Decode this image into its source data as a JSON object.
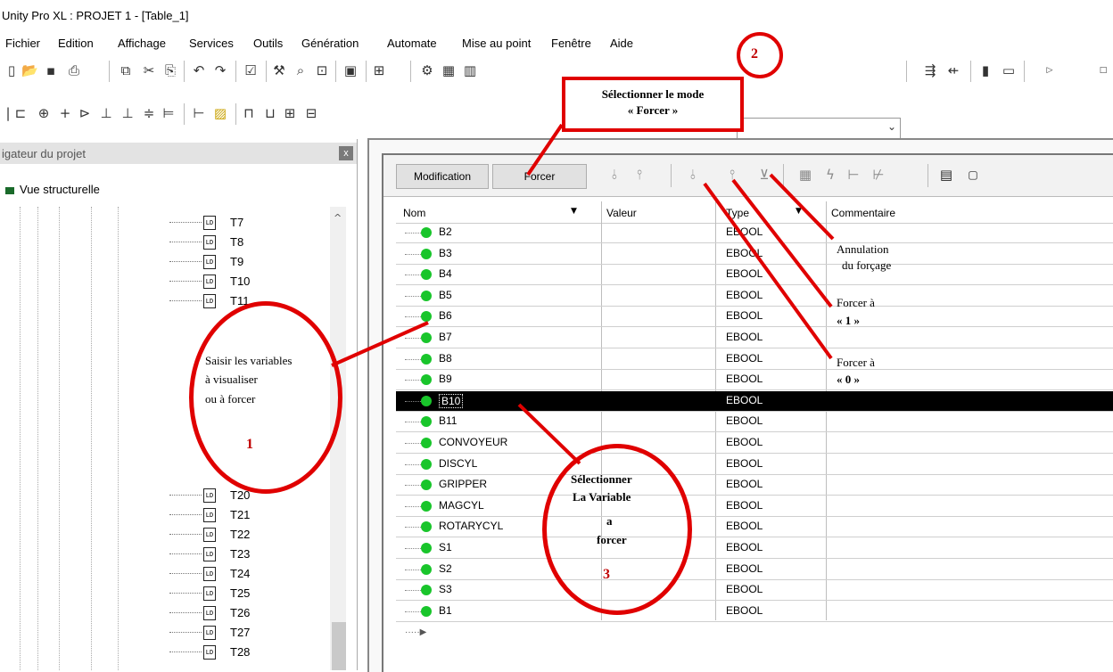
{
  "window": {
    "title": "Unity Pro XL : PROJET 1 - [Table_1]"
  },
  "menu": [
    "Fichier",
    "Edition",
    "Affichage",
    "Services",
    "Outils",
    "Génération",
    "Automate",
    "Mise au point",
    "Fenêtre",
    "Aide"
  ],
  "navigator": {
    "header": "igateur du projet",
    "close": "x",
    "structural_view": "Vue structurelle",
    "tree_items": [
      "T7",
      "T8",
      "T9",
      "T10",
      "T11",
      "T20",
      "T21",
      "T22",
      "T23",
      "T24",
      "T25",
      "T26",
      "T27",
      "T28"
    ],
    "ld_icon_text": "LD"
  },
  "var_table": {
    "buttons": {
      "modification": "Modification",
      "forcer": "Forcer"
    },
    "columns": {
      "name": "Nom",
      "value": "Valeur",
      "type": "Type",
      "comment": "Commentaire"
    },
    "rows": [
      {
        "name": "B2",
        "type": "EBOOL"
      },
      {
        "name": "B3",
        "type": "EBOOL"
      },
      {
        "name": "B4",
        "type": "EBOOL"
      },
      {
        "name": "B5",
        "type": "EBOOL"
      },
      {
        "name": "B6",
        "type": "EBOOL"
      },
      {
        "name": "B7",
        "type": "EBOOL"
      },
      {
        "name": "B8",
        "type": "EBOOL"
      },
      {
        "name": "B9",
        "type": "EBOOL"
      },
      {
        "name": "B10",
        "type": "EBOOL",
        "selected": true
      },
      {
        "name": "B11",
        "type": "EBOOL"
      },
      {
        "name": "CONVOYEUR",
        "type": "EBOOL"
      },
      {
        "name": "DISCYL",
        "type": "EBOOL"
      },
      {
        "name": "GRIPPER",
        "type": "EBOOL"
      },
      {
        "name": "MAGCYL",
        "type": "EBOOL"
      },
      {
        "name": "ROTARYCYL",
        "type": "EBOOL"
      },
      {
        "name": "S1",
        "type": "EBOOL"
      },
      {
        "name": "S2",
        "type": "EBOOL"
      },
      {
        "name": "S3",
        "type": "EBOOL"
      },
      {
        "name": "B1",
        "type": "EBOOL"
      }
    ]
  },
  "annotations": {
    "step2_box": [
      "Sélectionner le mode",
      "« Forcer »"
    ],
    "step2_num": "2",
    "step1_text": [
      "Saisir les variables",
      "à visualiser",
      "ou à forcer"
    ],
    "step1_num": "1",
    "step3_text": [
      "Sélectionner",
      "La Variable",
      "a",
      "forcer"
    ],
    "step3_num": "3",
    "cancel_text": [
      "Annulation",
      "du forçage"
    ],
    "force1_text": [
      "Forcer à",
      "« 1 »"
    ],
    "force0_text": [
      "Forcer à",
      "« 0 »"
    ]
  },
  "colors": {
    "annotation": "#e00000",
    "bullet": "#19c52b",
    "selected_row": "#000000"
  }
}
